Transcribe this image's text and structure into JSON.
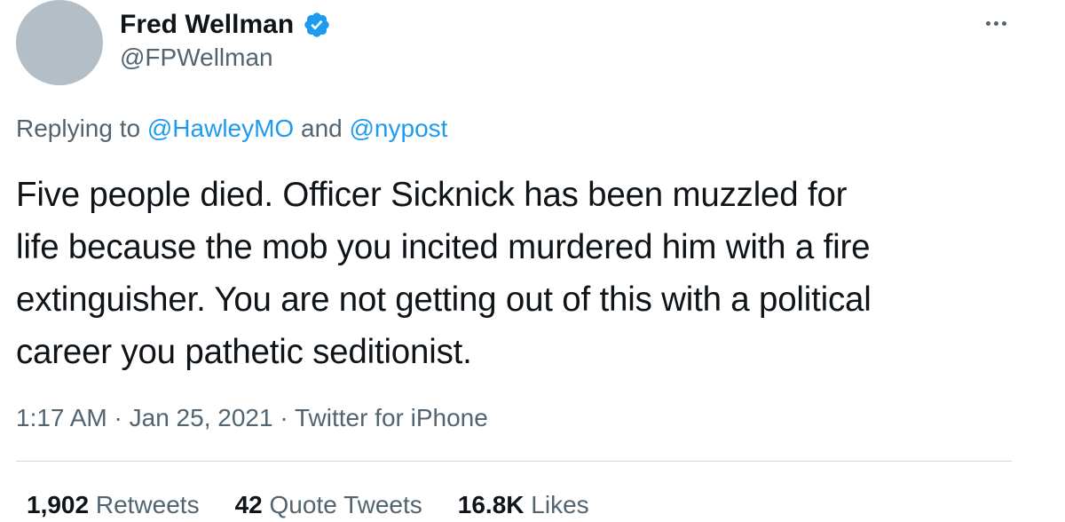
{
  "author": {
    "display_name": "Fred Wellman",
    "handle": "@FPWellman",
    "verified_icon": "verified-badge-icon",
    "avatar_color": "#b3bec6"
  },
  "menu": {
    "icon": "more-options-icon"
  },
  "reply": {
    "prefix": "Replying to",
    "mention_1": "@HawleyMO",
    "conjunction": "and",
    "mention_2": "@nypost"
  },
  "tweet": {
    "lines": [
      "Five people died. Officer Sicknick has been muzzled for",
      "life because the mob you incited murdered him with a fire",
      "extinguisher. You are not getting out of this with a political",
      "career you pathetic seditionist."
    ]
  },
  "meta": {
    "time": "1:17 AM",
    "separator": "·",
    "date": "Jan 25, 2021",
    "source": "Twitter for iPhone"
  },
  "stats": {
    "retweets_count": "1,902",
    "retweets_label": "Retweets",
    "quotes_count": "42",
    "quotes_label": "Quote Tweets",
    "likes_count": "16.8K",
    "likes_label": "Likes"
  },
  "colors": {
    "accent": "#1d9bf0",
    "secondary_text": "#536471",
    "primary_text": "#0f1419"
  }
}
